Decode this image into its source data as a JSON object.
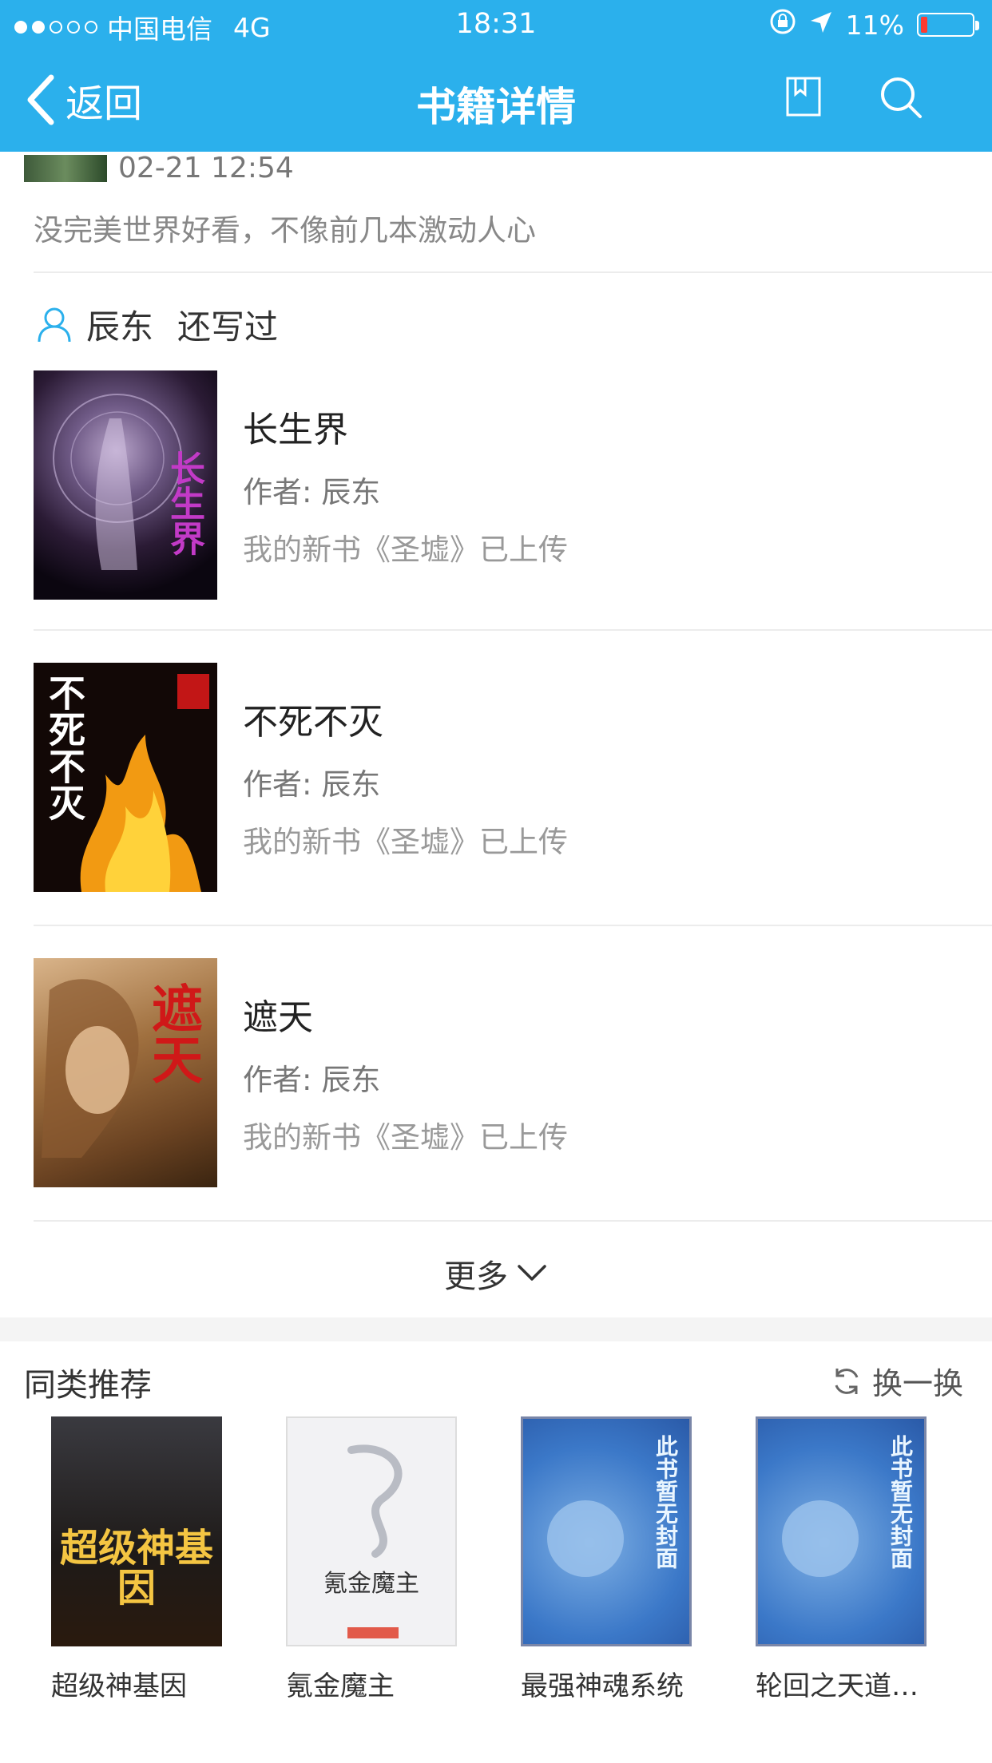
{
  "status_bar": {
    "carrier": "中国电信",
    "network": "4G",
    "time": "18:31",
    "battery": "11%"
  },
  "nav": {
    "back_label": "返回",
    "title": "书籍详情"
  },
  "comment": {
    "date": "02-21 12:54",
    "text": "没完美世界好看，不像前几本激动人心"
  },
  "author_section": {
    "author": "辰东",
    "label": "还写过"
  },
  "books": [
    {
      "name": "长生界",
      "author": "作者: 辰东",
      "desc": "我的新书《圣墟》已上传",
      "cover_text": "长生界"
    },
    {
      "name": "不死不灭",
      "author": "作者: 辰东",
      "desc": "我的新书《圣墟》已上传",
      "cover_text": "不死不灭"
    },
    {
      "name": "遮天",
      "author": "作者: 辰东",
      "desc": "我的新书《圣墟》已上传",
      "cover_text": "遮天"
    }
  ],
  "more_label": "更多",
  "recommend": {
    "title": "同类推荐",
    "refresh_label": "换一换",
    "items": [
      {
        "name": "超级神基因",
        "cover_text": "超级神基因"
      },
      {
        "name": "氪金魔主",
        "cover_text": "氪金魔主"
      },
      {
        "name": "最强神魂系统",
        "cover_text": "此书暂无封面"
      },
      {
        "name": "轮回之天道…",
        "cover_text": "此书暂无封面"
      }
    ]
  },
  "colors": {
    "accent": "#2bb0ec",
    "battery_low": "#ff3b30"
  }
}
